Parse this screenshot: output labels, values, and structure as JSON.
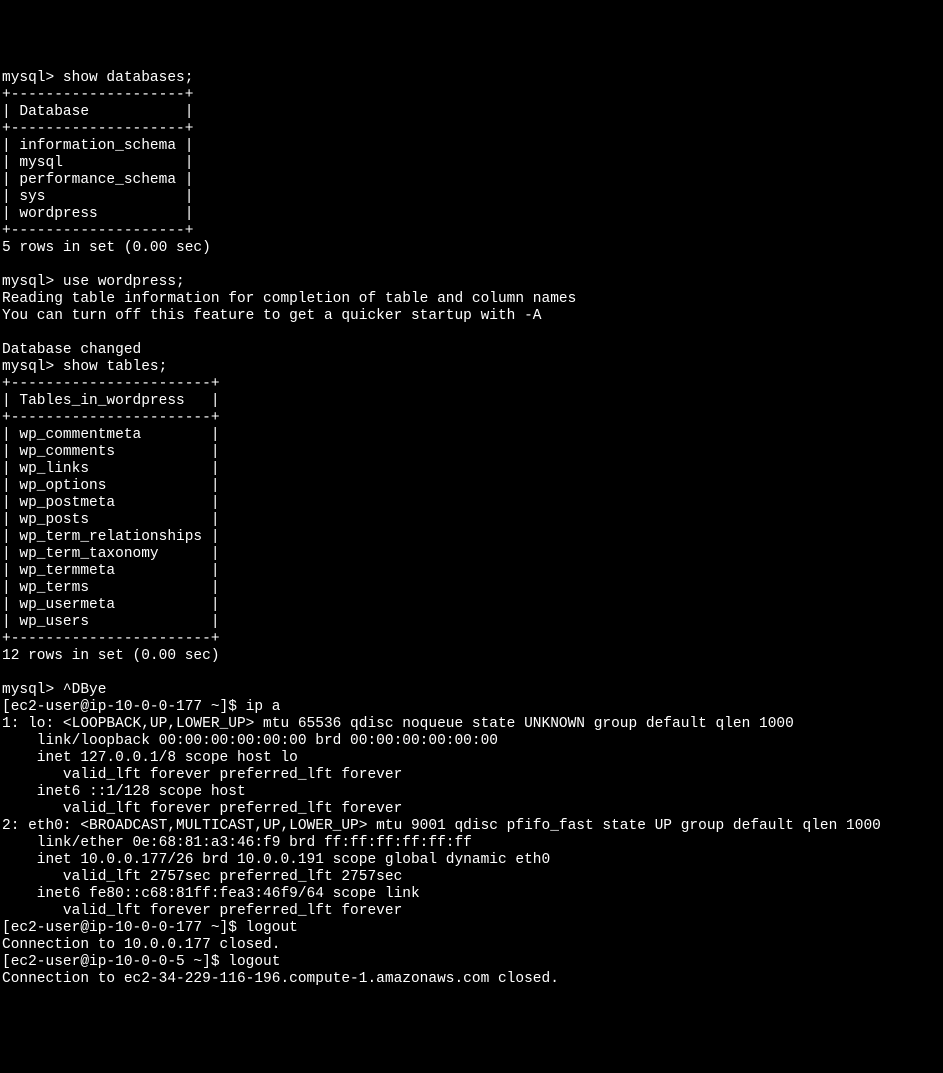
{
  "prompt1": "mysql>",
  "cmd1": "show databases;",
  "db_border_top": "+--------------------+",
  "db_header_open": "|",
  "db_header_label": "Database",
  "db_header_close": "|",
  "db_border_mid": "+--------------------+",
  "databases": [
    "information_schema",
    "mysql",
    "performance_schema",
    "sys",
    "wordpress"
  ],
  "db_border_bot": "+--------------------+",
  "db_result": "5 rows in set (0.00 sec)",
  "prompt2": "mysql>",
  "cmd2": "use wordpress;",
  "reading_msg": "Reading table information for completion of table and column names",
  "turnoff_msg": "You can turn off this feature to get a quicker startup with -A",
  "db_changed": "Database changed",
  "prompt3": "mysql>",
  "cmd3": "show tables;",
  "tbl_border_top": "+-----------------------+",
  "tbl_header_open": "|",
  "tbl_header_label": "Tables_in_wordpress",
  "tbl_header_close": "|",
  "tbl_border_mid": "+-----------------------+",
  "tables": [
    "wp_commentmeta",
    "wp_comments",
    "wp_links",
    "wp_options",
    "wp_postmeta",
    "wp_posts",
    "wp_term_relationships",
    "wp_term_taxonomy",
    "wp_termmeta",
    "wp_terms",
    "wp_usermeta",
    "wp_users"
  ],
  "tbl_border_bot": "+-----------------------+",
  "tbl_result": "12 rows in set (0.00 sec)",
  "prompt4": "mysql>",
  "bye": "^DBye",
  "shell_prompt1": "[ec2-user@ip-10-0-0-177 ~]$",
  "shell_cmd1": "ip a",
  "ip_output": {
    "l1": "1: lo: <LOOPBACK,UP,LOWER_UP> mtu 65536 qdisc noqueue state UNKNOWN group default qlen 1000",
    "l2": "    link/loopback 00:00:00:00:00:00 brd 00:00:00:00:00:00",
    "l3": "    inet 127.0.0.1/8 scope host lo",
    "l4": "       valid_lft forever preferred_lft forever",
    "l5": "    inet6 ::1/128 scope host",
    "l6": "       valid_lft forever preferred_lft forever",
    "l7": "2: eth0: <BROADCAST,MULTICAST,UP,LOWER_UP> mtu 9001 qdisc pfifo_fast state UP group default qlen 1000",
    "l8": "    link/ether 0e:68:81:a3:46:f9 brd ff:ff:ff:ff:ff:ff",
    "l9": "    inet 10.0.0.177/26 brd 10.0.0.191 scope global dynamic eth0",
    "l10": "       valid_lft 2757sec preferred_lft 2757sec",
    "l11": "    inet6 fe80::c68:81ff:fea3:46f9/64 scope link",
    "l12": "       valid_lft forever preferred_lft forever"
  },
  "shell_prompt2": "[ec2-user@ip-10-0-0-177 ~]$",
  "shell_cmd2": "logout",
  "conn_closed1": "Connection to 10.0.0.177 closed.",
  "shell_prompt3": "[ec2-user@ip-10-0-0-5 ~]$",
  "shell_cmd3": "logout",
  "conn_closed2": "Connection to ec2-34-229-116-196.compute-1.amazonaws.com closed."
}
